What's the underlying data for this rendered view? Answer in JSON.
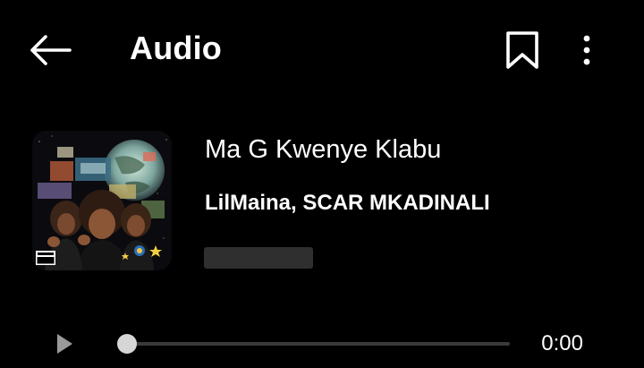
{
  "header": {
    "title": "Audio",
    "back_icon": "arrow-left-icon",
    "bookmark_icon": "bookmark-icon",
    "more_icon": "more-vertical-icon"
  },
  "track": {
    "title": "Ma G Kwenye Klabu",
    "artists": "LilMaina, SCAR MKADINALI",
    "cover_icon": "album-cover-art",
    "cover_badge": "PARENTAL ADVISORY EXPLICIT CONTENT"
  },
  "player": {
    "play_icon": "play-icon",
    "time": "0:00",
    "progress": 0
  },
  "colors": {
    "background": "#000000",
    "text": "#ffffff",
    "seek_track": "#3a3a3a",
    "seek_thumb": "#d6d6d6",
    "placeholder": "#2f2f2f"
  }
}
